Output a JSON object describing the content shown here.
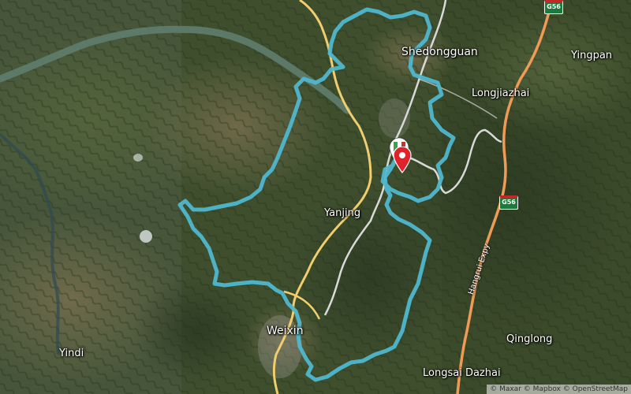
{
  "map": {
    "places": {
      "shedongguan": "Shedongguan",
      "yingpan": "Yingpan",
      "longjiazhai": "Longjiazhai",
      "yanjing": "Yanjing",
      "weixin": "Weixin",
      "yindi": "Yindi",
      "qinglong": "Qinglong",
      "longsai": "Longsai Dazhai"
    },
    "highway_shields": {
      "top": "G56",
      "mid": "G56"
    },
    "road_name": "Hangrui Expy",
    "attribution": "© Maxar © Mapbox © OpenStreetMap",
    "route_color": "#4fb7cf",
    "primary_road_color": "#f0cd6e",
    "secondary_road_color": "#d9d9d9",
    "highway_color": "#f09a58",
    "icons": {
      "start_marker": "flag-marker-icon",
      "end_marker": "pin-marker-icon"
    }
  }
}
